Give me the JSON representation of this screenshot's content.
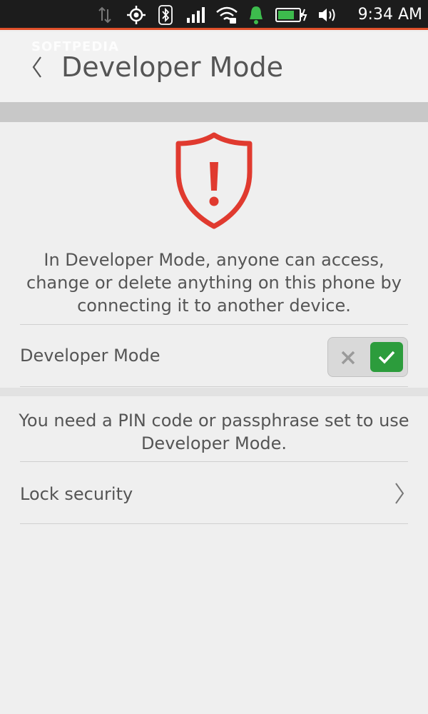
{
  "statusbar": {
    "time": "9:34 AM",
    "icons": [
      "data-transfer-icon",
      "location-icon",
      "bluetooth-icon",
      "signal-icon",
      "wifi-icon",
      "notification-bell-icon",
      "battery-icon",
      "volume-icon"
    ],
    "colors": {
      "background": "#1c1c1c",
      "accent": "#e0502a",
      "bell": "#3dbb4d",
      "battery": "#3dbb4d"
    }
  },
  "watermark": "SOFTPEDIA",
  "header": {
    "title": "Developer Mode"
  },
  "warning": {
    "icon": "shield-exclamation-icon",
    "color": "#e03a2f",
    "text": "In Developer Mode, anyone can access, change or delete anything on this phone by connecting it to another device."
  },
  "developer_mode": {
    "label": "Developer Mode",
    "toggle_on": true,
    "toggle_color": "#2c9c3c"
  },
  "pin_notice": {
    "text": "You need a PIN code or passphrase set to use Developer Mode."
  },
  "lock_security": {
    "label": "Lock security"
  }
}
